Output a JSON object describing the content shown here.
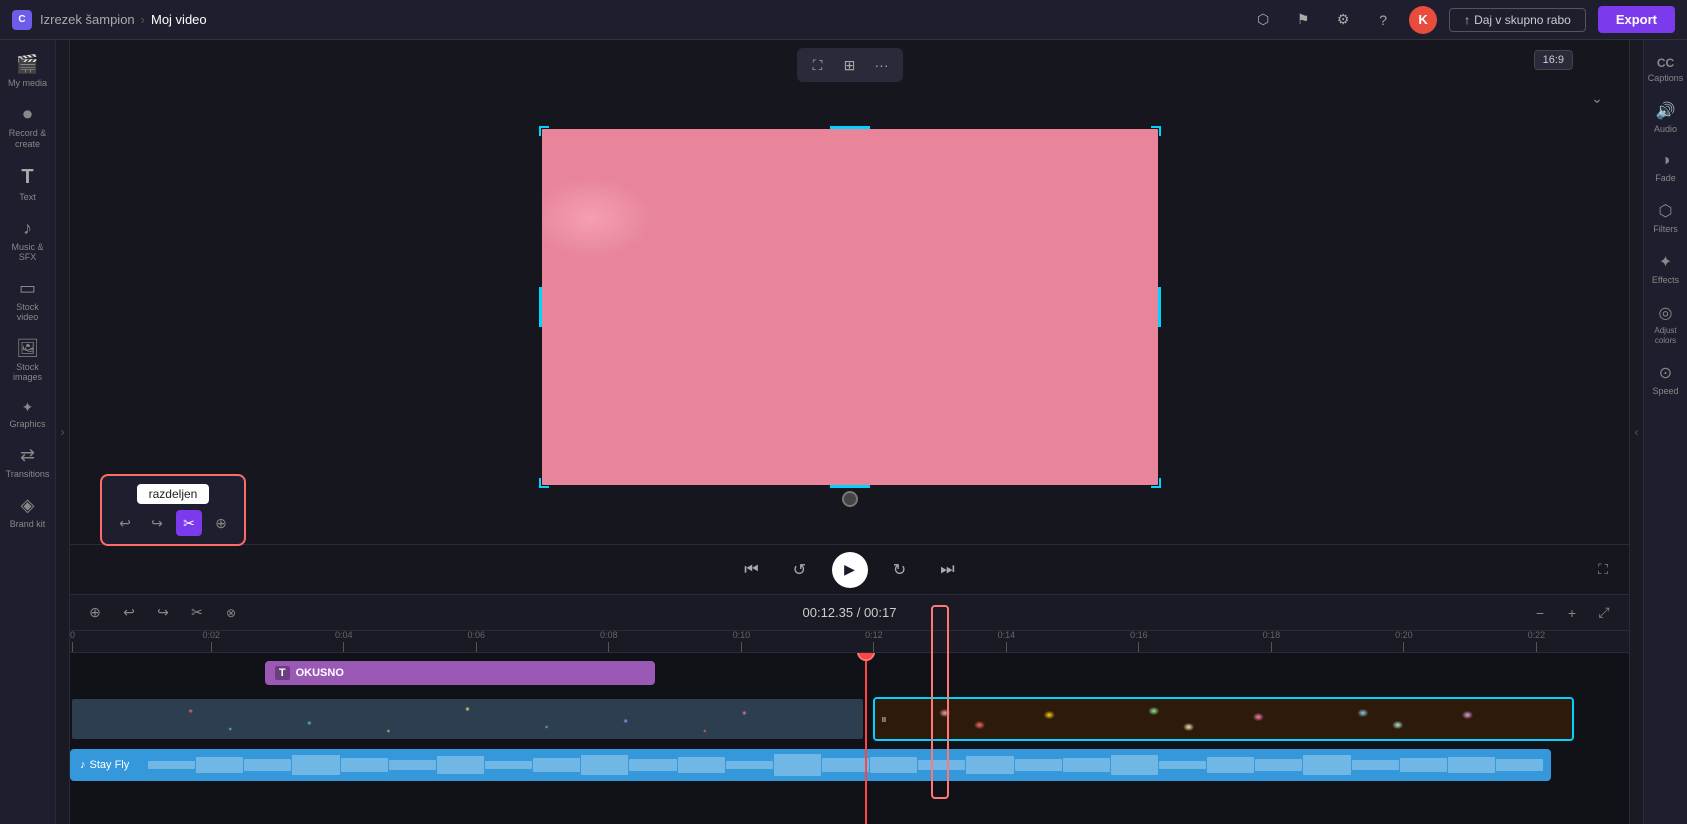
{
  "topbar": {
    "app_icon": "C",
    "project_name": "Izrezek šampion",
    "video_name": "Moj video",
    "share_label": "Daj v skupno rabo",
    "export_label": "Export",
    "avatar_letter": "K"
  },
  "sidebar": {
    "items": [
      {
        "id": "my-media",
        "icon": "🎬",
        "label": "My media"
      },
      {
        "id": "record-create",
        "icon": "⏺",
        "label": "Record & create"
      },
      {
        "id": "text",
        "icon": "T",
        "label": "Text"
      },
      {
        "id": "music-sfx",
        "icon": "🎵",
        "label": "Music & SFX"
      },
      {
        "id": "stock-video",
        "icon": "📹",
        "label": "Stock video"
      },
      {
        "id": "stock-images",
        "icon": "🖼",
        "label": "Stock images"
      },
      {
        "id": "graphics",
        "icon": "✦",
        "label": "Graphics"
      },
      {
        "id": "transitions",
        "icon": "⟷",
        "label": "Transitions"
      },
      {
        "id": "brand-kit",
        "icon": "◈",
        "label": "Brand kit"
      }
    ]
  },
  "preview_toolbar": {
    "crop_icon": "⛶",
    "expand_icon": "⊞",
    "more_icon": "···"
  },
  "aspect_ratio": "16:9",
  "playback": {
    "skip_back_icon": "⏮",
    "rewind_icon": "↺",
    "play_icon": "▶",
    "forward_icon": "↻",
    "skip_forward_icon": "⏭",
    "fullscreen_icon": "⛶"
  },
  "right_sidebar": {
    "items": [
      {
        "id": "captions",
        "icon": "CC",
        "label": "Captions"
      },
      {
        "id": "audio",
        "icon": "🔊",
        "label": "Audio"
      },
      {
        "id": "fade",
        "icon": "◑",
        "label": "Fade"
      },
      {
        "id": "filters",
        "icon": "⬡",
        "label": "Filters"
      },
      {
        "id": "effects",
        "icon": "✦",
        "label": "Effects"
      },
      {
        "id": "adjust-colors",
        "icon": "◎",
        "label": "Adjust colors"
      },
      {
        "id": "speed",
        "icon": "⊙",
        "label": "Speed"
      }
    ]
  },
  "timeline": {
    "current_time": "00:12.35",
    "total_time": "00:17",
    "time_display": "00:12.35 / 00:17",
    "tools": [
      {
        "id": "magnet",
        "icon": "⊕",
        "label": "Magnet"
      },
      {
        "id": "undo",
        "icon": "↩",
        "label": "Undo"
      },
      {
        "id": "redo",
        "icon": "↪",
        "label": "Redo"
      },
      {
        "id": "split",
        "icon": "✂",
        "label": "Split"
      },
      {
        "id": "delete",
        "icon": "🗑",
        "label": "Delete"
      }
    ],
    "zoom_out": "−",
    "zoom_in": "+",
    "expand": "⤢",
    "ruler_marks": [
      {
        "pos_pct": 0,
        "label": "0",
        "major": true
      },
      {
        "pos_pct": 8.5,
        "label": "0:02",
        "major": true
      },
      {
        "pos_pct": 17,
        "label": "0:04",
        "major": true
      },
      {
        "pos_pct": 25.5,
        "label": "0:06",
        "major": true
      },
      {
        "pos_pct": 34,
        "label": "0:08",
        "major": true
      },
      {
        "pos_pct": 42.5,
        "label": "0:10",
        "major": true
      },
      {
        "pos_pct": 51,
        "label": "0:12",
        "major": true
      },
      {
        "pos_pct": 59.5,
        "label": "0:14",
        "major": true
      },
      {
        "pos_pct": 68,
        "label": "0:16",
        "major": true
      },
      {
        "pos_pct": 76.5,
        "label": "0:18",
        "major": true
      },
      {
        "pos_pct": 85,
        "label": "0:20",
        "major": true
      },
      {
        "pos_pct": 93.5,
        "label": "0:22",
        "major": true
      }
    ],
    "tracks": {
      "title_bar": {
        "text": "OKUSNO",
        "color": "#9b59b6",
        "start_pct": 12,
        "width_pct": 26
      },
      "video_segment1": {
        "start_pct": 0,
        "width_pct": 51,
        "type": "donuts"
      },
      "video_segment2": {
        "start_pct": 51,
        "width_pct": 46,
        "type": "macarons"
      },
      "audio_track": {
        "label": "Stay Fly",
        "color": "#3498db",
        "start_pct": 0,
        "width_pct": 96
      }
    },
    "playhead_pct": 51,
    "split_tooltip": "razdeljen"
  },
  "split_popup": {
    "tooltip_label": "razdeljen",
    "tools": [
      "↩",
      "↪",
      "✂",
      "⊕"
    ]
  }
}
